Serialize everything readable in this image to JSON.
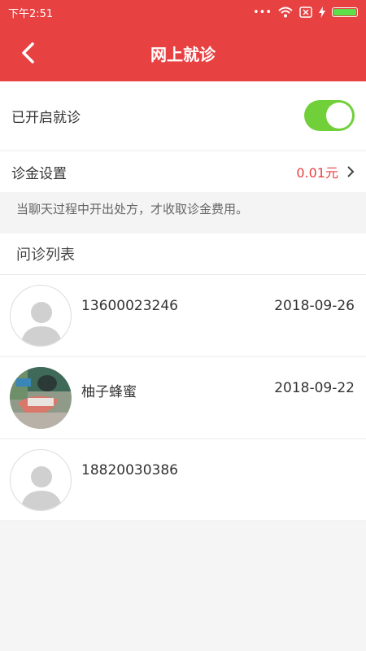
{
  "status_bar": {
    "time": "下午2:51"
  },
  "header": {
    "title": "网上就诊"
  },
  "settings": {
    "enable_label": "已开启就诊",
    "enabled": true,
    "fee_label": "诊金设置",
    "fee_value": "0.01元",
    "hint": "当聊天过程中开出处方，才收取诊金费用。"
  },
  "list": {
    "title": "问诊列表",
    "items": [
      {
        "name": "13600023246",
        "date": "2018-09-26",
        "avatar": "default-avatar"
      },
      {
        "name": "柚子蜂蜜",
        "date": "2018-09-22",
        "avatar": "photo-avatar"
      },
      {
        "name": "18820030386",
        "date": "",
        "avatar": "default-avatar"
      }
    ]
  },
  "colors": {
    "brand": "#e84142",
    "toggle_on": "#71cf3a",
    "fee": "#e84142"
  }
}
